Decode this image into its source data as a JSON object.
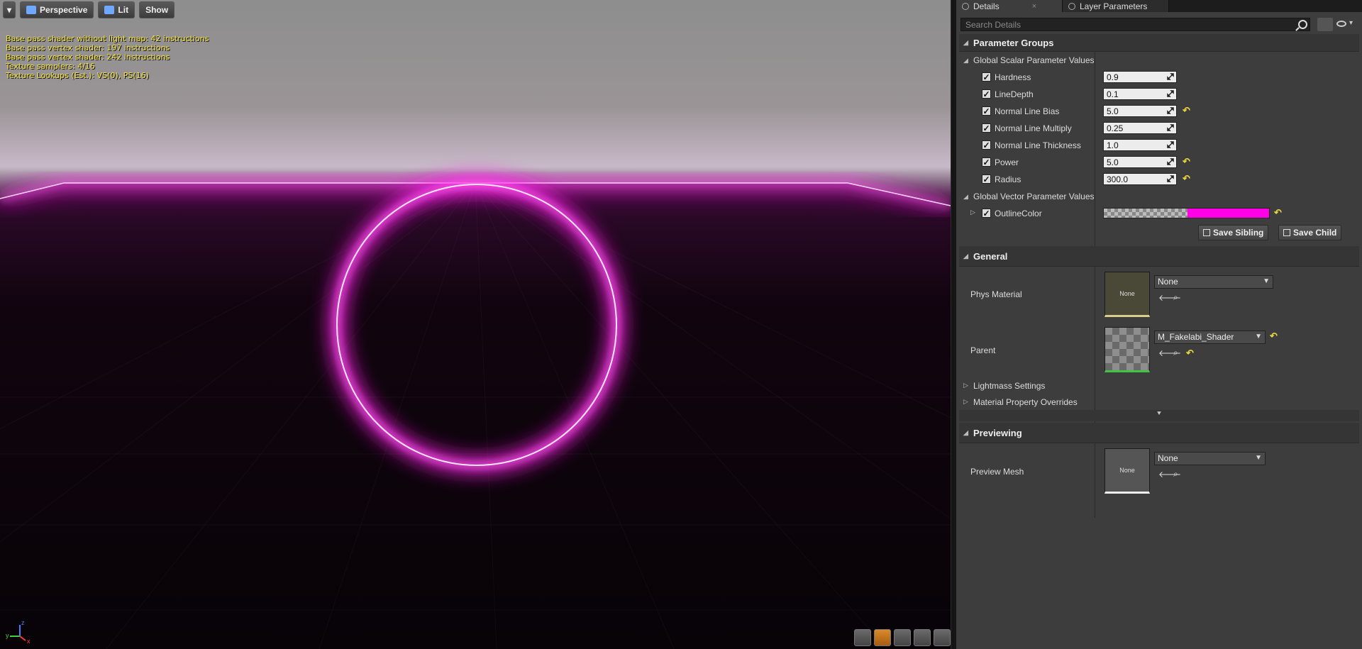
{
  "viewport": {
    "toolbar": {
      "menu_caret": "▾",
      "perspective_label": "Perspective",
      "lit_label": "Lit",
      "show_label": "Show"
    },
    "stats": [
      "Base pass shader without light map: 42 instructions",
      "Base pass vertex shader: 197 instructions",
      "Base pass vertex shader: 242 instructions",
      "Texture samplers: 4/16",
      "Texture Lookups (Est.): VS(0), PS(16)"
    ],
    "glow_color": "#ff1ee8",
    "axis": {
      "x": "x",
      "y": "y",
      "z": "z"
    }
  },
  "panel": {
    "tabs": [
      {
        "label": "Details",
        "close": "×"
      },
      {
        "label": "Layer Parameters"
      }
    ],
    "search": {
      "placeholder": "Search Details"
    },
    "parameter_groups": {
      "title": "Parameter Groups",
      "scalar_group": "Global Scalar Parameter Values",
      "scalars": [
        {
          "name": "Hardness",
          "value": "0.9",
          "reset": false
        },
        {
          "name": "LineDepth",
          "value": "0.1",
          "reset": false
        },
        {
          "name": "Normal Line Bias",
          "value": "5.0",
          "reset": true
        },
        {
          "name": "Normal Line Multiply",
          "value": "0.25",
          "reset": false
        },
        {
          "name": "Normal Line Thickness",
          "value": "1.0",
          "reset": false
        },
        {
          "name": "Power",
          "value": "5.0",
          "reset": true
        },
        {
          "name": "Radius",
          "value": "300.0",
          "reset": true
        }
      ],
      "vector_group": "Global Vector Parameter Values",
      "vector": {
        "name": "OutlineColor",
        "color": "#ff00e6"
      },
      "save_sibling": "Save Sibling",
      "save_child": "Save Child",
      "reset_glyph": "↶"
    },
    "general": {
      "title": "General",
      "phys_material": {
        "label": "Phys Material",
        "thumb": "None",
        "value": "None"
      },
      "parent": {
        "label": "Parent",
        "value": "M_Fakelabi_Shader"
      },
      "lightmass": "Lightmass Settings",
      "overrides": "Material Property Overrides"
    },
    "previewing": {
      "title": "Previewing",
      "preview_mesh": {
        "label": "Preview Mesh",
        "thumb": "None",
        "value": "None"
      }
    }
  }
}
